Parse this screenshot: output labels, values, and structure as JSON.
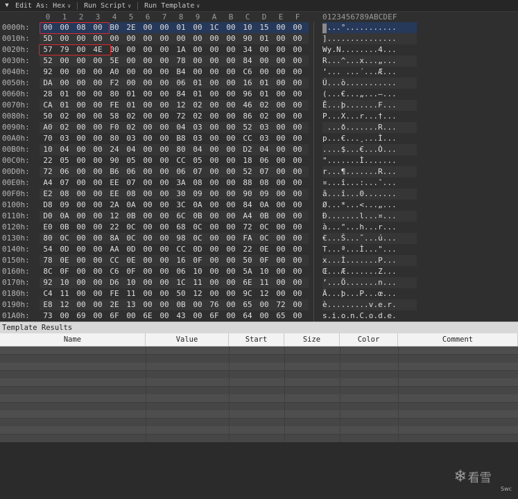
{
  "toolbar": {
    "collapse_icon": "collapse-triangle-icon",
    "edit_as": "Edit As: Hex",
    "run_script": "Run Script",
    "run_template": "Run Template"
  },
  "hex": {
    "columns": [
      "0",
      "1",
      "2",
      "3",
      "4",
      "5",
      "6",
      "7",
      "8",
      "9",
      "A",
      "B",
      "C",
      "D",
      "E",
      "F"
    ],
    "ascii_header": "0123456789ABCDEF",
    "rows": [
      {
        "addr": "0000h:",
        "bytes": [
          "00",
          "00",
          "08",
          "00",
          "B0",
          "2E",
          "00",
          "00",
          "01",
          "00",
          "1C",
          "00",
          "10",
          "15",
          "00",
          "00"
        ],
        "ascii": "....°..........."
      },
      {
        "addr": "0010h:",
        "bytes": [
          "5D",
          "00",
          "00",
          "00",
          "00",
          "00",
          "00",
          "00",
          "00",
          "00",
          "00",
          "00",
          "90",
          "01",
          "00",
          "00"
        ],
        "ascii": "]..............."
      },
      {
        "addr": "0020h:",
        "bytes": [
          "57",
          "79",
          "00",
          "4E",
          "00",
          "00",
          "00",
          "00",
          "1A",
          "00",
          "00",
          "00",
          "34",
          "00",
          "00",
          "00"
        ],
        "ascii": "Wy.N........4..."
      },
      {
        "addr": "0030h:",
        "bytes": [
          "52",
          "00",
          "00",
          "00",
          "5E",
          "00",
          "00",
          "00",
          "78",
          "00",
          "00",
          "00",
          "84",
          "00",
          "00",
          "00"
        ],
        "ascii": "R...^...x...„..."
      },
      {
        "addr": "0040h:",
        "bytes": [
          "92",
          "00",
          "00",
          "00",
          "A0",
          "00",
          "00",
          "00",
          "B4",
          "00",
          "00",
          "00",
          "C6",
          "00",
          "00",
          "00"
        ],
        "ascii": "’... ...´...Æ..."
      },
      {
        "addr": "0050h:",
        "bytes": [
          "DA",
          "00",
          "00",
          "00",
          "F2",
          "00",
          "00",
          "00",
          "06",
          "01",
          "00",
          "00",
          "16",
          "01",
          "00",
          "00"
        ],
        "ascii": "Ú...ò..........."
      },
      {
        "addr": "0060h:",
        "bytes": [
          "28",
          "01",
          "00",
          "00",
          "80",
          "01",
          "00",
          "00",
          "84",
          "01",
          "00",
          "00",
          "96",
          "01",
          "00",
          "00"
        ],
        "ascii": "(...€...„...–..."
      },
      {
        "addr": "0070h:",
        "bytes": [
          "CA",
          "01",
          "00",
          "00",
          "FE",
          "01",
          "00",
          "00",
          "12",
          "02",
          "00",
          "00",
          "46",
          "02",
          "00",
          "00"
        ],
        "ascii": "Ê...þ.......F..."
      },
      {
        "addr": "0080h:",
        "bytes": [
          "50",
          "02",
          "00",
          "00",
          "58",
          "02",
          "00",
          "00",
          "72",
          "02",
          "00",
          "00",
          "86",
          "02",
          "00",
          "00"
        ],
        "ascii": "P...X...r...†..."
      },
      {
        "addr": "0090h:",
        "bytes": [
          "A0",
          "02",
          "00",
          "00",
          "F0",
          "02",
          "00",
          "00",
          "04",
          "03",
          "00",
          "00",
          "52",
          "03",
          "00",
          "00"
        ],
        "ascii": " ...ð.......R..."
      },
      {
        "addr": "00A0h:",
        "bytes": [
          "70",
          "03",
          "00",
          "00",
          "80",
          "03",
          "00",
          "00",
          "B8",
          "03",
          "00",
          "00",
          "CC",
          "03",
          "00",
          "00"
        ],
        "ascii": "p...€...¸...Ì..."
      },
      {
        "addr": "00B0h:",
        "bytes": [
          "10",
          "04",
          "00",
          "00",
          "24",
          "04",
          "00",
          "00",
          "80",
          "04",
          "00",
          "00",
          "D2",
          "04",
          "00",
          "00"
        ],
        "ascii": "....$...€...Ò..."
      },
      {
        "addr": "00C0h:",
        "bytes": [
          "22",
          "05",
          "00",
          "00",
          "90",
          "05",
          "00",
          "00",
          "CC",
          "05",
          "00",
          "00",
          "18",
          "06",
          "00",
          "00"
        ],
        "ascii": "\".......Ì......."
      },
      {
        "addr": "00D0h:",
        "bytes": [
          "72",
          "06",
          "00",
          "00",
          "B6",
          "06",
          "00",
          "00",
          "06",
          "07",
          "00",
          "00",
          "52",
          "07",
          "00",
          "00"
        ],
        "ascii": "r...¶.......R..."
      },
      {
        "addr": "00E0h:",
        "bytes": [
          "A4",
          "07",
          "00",
          "00",
          "EE",
          "07",
          "00",
          "00",
          "3A",
          "08",
          "00",
          "00",
          "88",
          "08",
          "00",
          "00"
        ],
        "ascii": "¤...î...:...ˆ..."
      },
      {
        "addr": "00F0h:",
        "bytes": [
          "E2",
          "08",
          "00",
          "00",
          "EE",
          "08",
          "00",
          "00",
          "30",
          "09",
          "00",
          "00",
          "90",
          "09",
          "00",
          "00"
        ],
        "ascii": "â...î...0......."
      },
      {
        "addr": "0100h:",
        "bytes": [
          "D8",
          "09",
          "00",
          "00",
          "2A",
          "0A",
          "00",
          "00",
          "3C",
          "0A",
          "00",
          "00",
          "84",
          "0A",
          "00",
          "00"
        ],
        "ascii": "Ø...*...<...„..."
      },
      {
        "addr": "0110h:",
        "bytes": [
          "D0",
          "0A",
          "00",
          "00",
          "12",
          "0B",
          "00",
          "00",
          "6C",
          "0B",
          "00",
          "00",
          "A4",
          "0B",
          "00",
          "00"
        ],
        "ascii": "Ð.......l...¤..."
      },
      {
        "addr": "0120h:",
        "bytes": [
          "E0",
          "0B",
          "00",
          "00",
          "22",
          "0C",
          "00",
          "00",
          "68",
          "0C",
          "00",
          "00",
          "72",
          "0C",
          "00",
          "00"
        ],
        "ascii": "à...\"...h...r..."
      },
      {
        "addr": "0130h:",
        "bytes": [
          "80",
          "0C",
          "00",
          "00",
          "8A",
          "0C",
          "00",
          "00",
          "98",
          "0C",
          "00",
          "00",
          "FA",
          "0C",
          "00",
          "00"
        ],
        "ascii": "€...Š...˜...ú..."
      },
      {
        "addr": "0140h:",
        "bytes": [
          "54",
          "0D",
          "00",
          "00",
          "AA",
          "0D",
          "00",
          "00",
          "CC",
          "0D",
          "00",
          "00",
          "22",
          "0E",
          "00",
          "00"
        ],
        "ascii": "T...ª...Ì...\"..."
      },
      {
        "addr": "0150h:",
        "bytes": [
          "78",
          "0E",
          "00",
          "00",
          "CC",
          "0E",
          "00",
          "00",
          "16",
          "0F",
          "00",
          "00",
          "50",
          "0F",
          "00",
          "00"
        ],
        "ascii": "x...Ì.......P..."
      },
      {
        "addr": "0160h:",
        "bytes": [
          "8C",
          "0F",
          "00",
          "00",
          "C6",
          "0F",
          "00",
          "00",
          "06",
          "10",
          "00",
          "00",
          "5A",
          "10",
          "00",
          "00"
        ],
        "ascii": "Œ...Æ.......Z..."
      },
      {
        "addr": "0170h:",
        "bytes": [
          "92",
          "10",
          "00",
          "00",
          "D6",
          "10",
          "00",
          "00",
          "1C",
          "11",
          "00",
          "00",
          "6E",
          "11",
          "00",
          "00"
        ],
        "ascii": "’...Ö.......n..."
      },
      {
        "addr": "0180h:",
        "bytes": [
          "C4",
          "11",
          "00",
          "00",
          "FE",
          "11",
          "00",
          "00",
          "50",
          "12",
          "00",
          "00",
          "9C",
          "12",
          "00",
          "00"
        ],
        "ascii": "Ä...þ...P...œ..."
      },
      {
        "addr": "0190h:",
        "bytes": [
          "E8",
          "12",
          "00",
          "00",
          "2E",
          "13",
          "00",
          "00",
          "0B",
          "00",
          "76",
          "00",
          "65",
          "00",
          "72",
          "00"
        ],
        "ascii": "è.........v.e.r."
      },
      {
        "addr": "01A0h:",
        "bytes": [
          "73",
          "00",
          "69",
          "00",
          "6F",
          "00",
          "6E",
          "00",
          "43",
          "00",
          "6F",
          "00",
          "64",
          "00",
          "65",
          "00"
        ],
        "ascii": "s.i.o.n.C.o.d.e."
      }
    ]
  },
  "template_results": {
    "title": "Template Results",
    "columns": [
      "Name",
      "Value",
      "Start",
      "Size",
      "Color",
      "Comment"
    ]
  },
  "watermark": {
    "icon": "snowflake-icon",
    "text": "看雪",
    "sub": "Swc"
  }
}
